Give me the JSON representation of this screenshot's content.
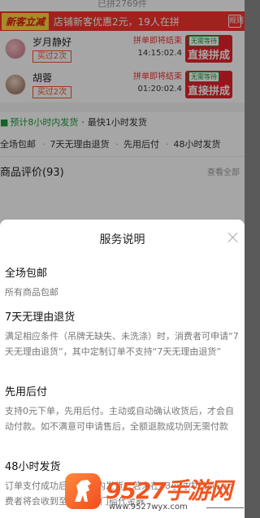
{
  "background": {
    "sold_text": "已拼2769件",
    "promo": {
      "new_badge": "新客立减",
      "text": "店铺新客优惠2元，19人在拼",
      "rule_label": "规则"
    },
    "groups": [
      {
        "name": "岁月静好",
        "tag": "买过2次",
        "status": "拼单即将结束",
        "time": "14:15:02.4",
        "badge": "无需等待",
        "button": "直接拼成"
      },
      {
        "name": "胡蓉",
        "tag": "买过2次",
        "status": "拼单即将结束",
        "time": "01:20:02.4",
        "badge": "无需等待",
        "button": "直接拼成"
      }
    ],
    "shipping": {
      "estimate": "预计8小时内发货",
      "fastest": "最快1小时发货"
    },
    "services_row": [
      "全场包邮",
      "7天无理由退货",
      "先用后付",
      "48小时发货"
    ],
    "reviews": {
      "title": "商品评价(93)",
      "view_all": "查看全部"
    }
  },
  "sheet": {
    "title": "服务说明",
    "items": [
      {
        "title": "全场包邮",
        "desc": "所有商品包邮"
      },
      {
        "title": "7天无理由退货",
        "desc": "满足相应条件（吊牌无缺失、未洗涤）时，消费者可申请“7天无理由退货”，其中定制订单不支持“7天无理由退货”"
      },
      {
        "title": "先用后付",
        "desc": "支持0元下单，先用后付。主动或自动确认收货后，才会自动付款。如不满意可申请售后，全额退款成功则无需付款"
      },
      {
        "title": "48小时发货",
        "desc": "订单支付成功后48小时内发货，若未在48小时内发货，消费者将会收到至少3元无门槛代金券"
      }
    ]
  },
  "watermark": {
    "brand": "9527手游网",
    "url": "www.9527wyx.com"
  },
  "colors": {
    "accent_red": "#e8232a",
    "green": "#1a9b3a",
    "watermark_orange": "#f2541e"
  }
}
